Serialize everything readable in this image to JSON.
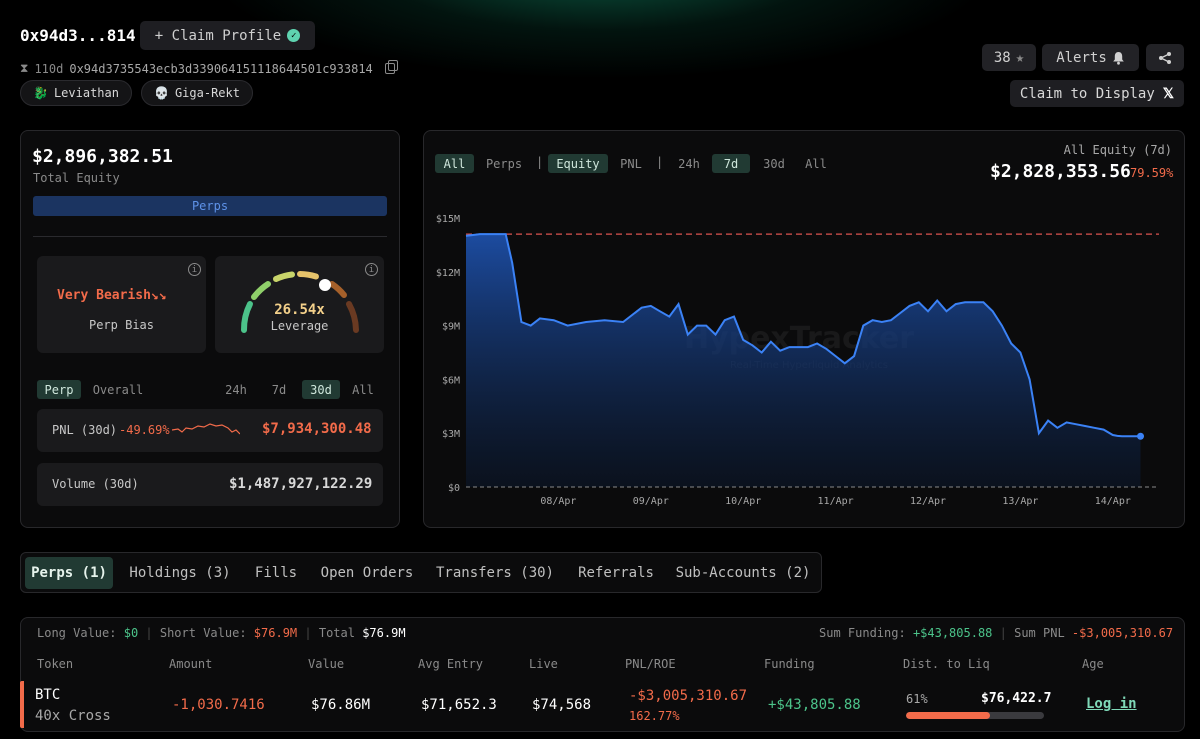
{
  "header": {
    "address_short": "0x94d3...814",
    "claim_profile_label": "+ Claim Profile",
    "age": "110d",
    "address_full": "0x94d3735543ecb3d339064151118644501c933814",
    "tags": [
      {
        "emoji": "🐉",
        "label": "Leviathan"
      },
      {
        "emoji": "💀",
        "label": "Giga-Rekt"
      }
    ],
    "count": "38",
    "alerts_label": "Alerts",
    "claim_display_label": "Claim to Display"
  },
  "summary": {
    "total_equity": "$2,896,382.51",
    "total_equity_label": "Total Equity",
    "perps_bar_label": "Perps",
    "bias_value": "Very Bearish",
    "bias_label": "Perp Bias",
    "leverage_value": "26.54x",
    "leverage_label": "Leverage",
    "scope_tabs": [
      "Perp",
      "Overall"
    ],
    "range_tabs": [
      "24h",
      "7d",
      "30d",
      "All"
    ],
    "pnl_label": "PNL (30d)",
    "pnl_pct": "-49.69%",
    "pnl_value": "$7,934,300.48",
    "volume_label": "Volume (30d)",
    "volume_value": "$1,487,927,122.29"
  },
  "chart_panel": {
    "filter_tabs": [
      "All",
      "Perps",
      "Equity",
      "PNL",
      "24h",
      "7d",
      "30d",
      "All"
    ],
    "separator": "|",
    "equity_label": "All Equity (7d)",
    "equity_value": "$2,828,353.56",
    "equity_pct": "79.59%",
    "watermark": "HypexTracker",
    "watermark_sub": "Real-Time Hyperliquid Analytics"
  },
  "chart_data": {
    "type": "area",
    "x_labels": [
      "08/Apr",
      "09/Apr",
      "10/Apr",
      "11/Apr",
      "12/Apr",
      "13/Apr",
      "14/Apr"
    ],
    "y_ticks": [
      "$0",
      "$3M",
      "$6M",
      "$9M",
      "$12M",
      "$15M"
    ],
    "ylim": [
      0,
      15000000
    ],
    "reference_line": 14100000,
    "x": [
      7.0,
      7.15,
      7.43,
      7.5,
      7.6,
      7.7,
      7.8,
      7.95,
      8.1,
      8.3,
      8.5,
      8.7,
      8.9,
      9.0,
      9.1,
      9.2,
      9.3,
      9.4,
      9.5,
      9.6,
      9.7,
      9.8,
      9.9,
      10.0,
      10.1,
      10.2,
      10.3,
      10.4,
      10.5,
      10.6,
      10.7,
      10.8,
      10.9,
      11.0,
      11.1,
      11.2,
      11.3,
      11.4,
      11.5,
      11.6,
      11.7,
      11.8,
      11.9,
      12.0,
      12.1,
      12.2,
      12.3,
      12.4,
      12.5,
      12.6,
      12.7,
      12.8,
      12.9,
      13.0,
      13.1,
      13.2,
      13.3,
      13.4,
      13.5,
      13.6,
      13.7,
      13.8,
      13.9,
      14.0,
      14.05,
      14.1,
      14.2,
      14.3,
      14.4,
      14.5
    ],
    "values": [
      14000000,
      14100000,
      14100000,
      12500000,
      9200000,
      9000000,
      9400000,
      9300000,
      9000000,
      9200000,
      9300000,
      9200000,
      10000000,
      10100000,
      9800000,
      9500000,
      10200000,
      8500000,
      9000000,
      9000000,
      8500000,
      9300000,
      9500000,
      8200000,
      7900000,
      7500000,
      8100000,
      7600000,
      7800000,
      7800000,
      7800000,
      8000000,
      7700000,
      7300000,
      6900000,
      7300000,
      9000000,
      9300000,
      9200000,
      9300000,
      9700000,
      10100000,
      10300000,
      9800000,
      10400000,
      9800000,
      10200000,
      10300000,
      10300000,
      10300000,
      9800000,
      9000000,
      8000000,
      7500000,
      6000000,
      3000000,
      3700000,
      3300000,
      3600000,
      3500000,
      3400000,
      3300000,
      3200000,
      2900000,
      2850000,
      2828353,
      2828353,
      2828353,
      2828353,
      2828353
    ],
    "series": [
      {
        "name": "All Equity (7d)",
        "color": "#3b82f6"
      }
    ],
    "grid": false
  },
  "tabs": [
    {
      "label": "Perps (1)",
      "active": true
    },
    {
      "label": "Holdings (3)",
      "active": false
    },
    {
      "label": "Fills",
      "active": false
    },
    {
      "label": "Open Orders",
      "active": false
    },
    {
      "label": "Transfers (30)",
      "active": false
    },
    {
      "label": "Referrals",
      "active": false
    },
    {
      "label": "Sub-Accounts (2)",
      "active": false
    }
  ],
  "positions_summary": {
    "long_label": "Long Value:",
    "long_value": "$0",
    "short_label": "Short Value:",
    "short_value": "$76.9M",
    "total_label": "Total",
    "total_value": "$76.9M",
    "sum_funding_label": "Sum Funding:",
    "sum_funding_value": "+$43,805.88",
    "sum_pnl_label": "Sum PNL",
    "sum_pnl_value": "-$3,005,310.67"
  },
  "table": {
    "columns": [
      "Token",
      "Amount",
      "Value",
      "Avg Entry",
      "Live",
      "PNL/ROE",
      "Funding",
      "Dist. to Liq",
      "Age"
    ],
    "rows": [
      {
        "token": "BTC",
        "mode": "40x Cross",
        "amount": "-1,030.7416",
        "value": "$76.86M",
        "avg_entry": "$71,652.3",
        "live": "$74,568",
        "pnl": "-$3,005,310.67",
        "roe": "162.77%",
        "funding": "+$43,805.88",
        "dist_pct": "61%",
        "liq_price": "$76,422.7",
        "dist_fraction": 0.61,
        "age": "Log in"
      }
    ]
  },
  "colors": {
    "accent": "#4cc38a",
    "negative": "#f26b4a",
    "line": "#3b82f6"
  }
}
